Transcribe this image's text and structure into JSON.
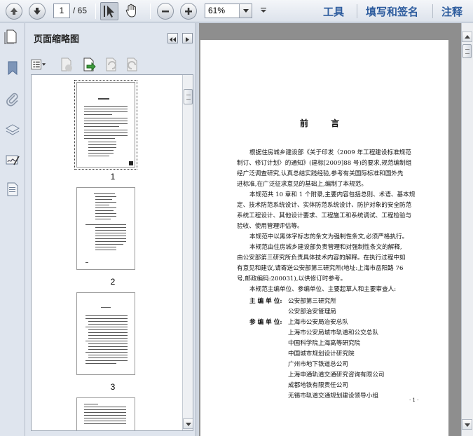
{
  "toolbar": {
    "page_current": "1",
    "page_total": "/ 65",
    "zoom": "61%",
    "menus": [
      "工具",
      "填写和签名",
      "注释"
    ]
  },
  "sidebar": {
    "title": "页面缩略图",
    "thumbnails": [
      {
        "label": "1"
      },
      {
        "label": "2"
      },
      {
        "label": "3"
      }
    ]
  },
  "document": {
    "title": "前 言",
    "paragraphs": [
      [
        "根据住房城乡建设部《关于印发〈2009 年工程建设标准规范",
        "制订、修订计划〉的通知》(建标[2009]88 号)的要求,规范编制组",
        "经广泛调查研究,认真总结实践经验,参考有关国际标准和国外先",
        "进标准,在广泛征求意见的基础上,编制了本规范。"
      ],
      [
        "本规范共 10 章和 1 个附录,主要内容包括总则、术语、基本规",
        "定、技术防范系统设计、实体防范系统设计、防护对象的安全防范",
        "系统工程设计、其他设计要求、工程施工和系统调试、工程检验与",
        "验收、使用管理评估等。"
      ],
      [
        "本规范中以黑体字标志的条文为强制性条文,必须严格执行。"
      ],
      [
        "本规范由住房城乡建设部负责管理和对强制性条文的解释,",
        "由公安部第三研究所负责具体技术内容的解释。在执行过程中如",
        "有意见和建议,请寄送公安部第三研究所(地址:上海市岳阳路 76",
        "号,邮政编码:200031),以供修订时参考。"
      ],
      [
        "本规范主编单位、参编单位、主要起草人和主要审查人:"
      ]
    ],
    "chief_label": "主 编 单 位:",
    "chief_units": [
      "公安部第三研究所",
      "公安部治安管理局"
    ],
    "participant_label": "参 编 单 位:",
    "participant_units": [
      "上海市公安局治安总队",
      "上海市公安局城市轨道和公交总队",
      "中国科学院上海高等研究院",
      "中国城市规划设计研究院",
      "广州市地下铁道总公司",
      "上海申通轨道交通研究咨询有限公司",
      "成都地铁有限责任公司",
      "无锡市轨道交通规划建设领导小组"
    ],
    "page_number": "· 1 ·"
  }
}
